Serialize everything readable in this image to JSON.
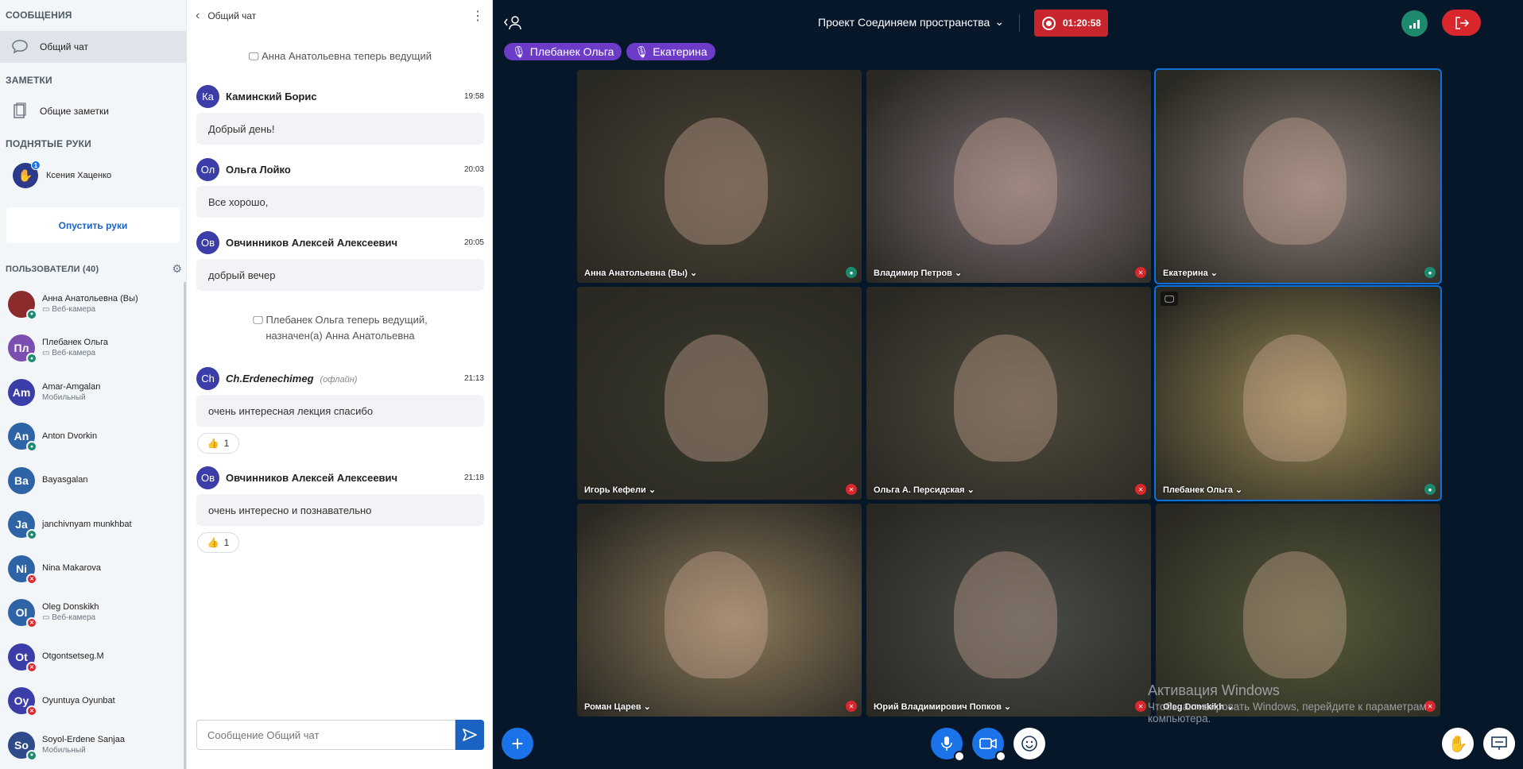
{
  "sidebar": {
    "messages_title": "СООБЩЕНИЯ",
    "public_chat": "Общий чат",
    "notes_title": "ЗАМЕТКИ",
    "shared_notes": "Общие заметки",
    "raised_hands_title": "ПОДНЯТЫЕ РУКИ",
    "raised_hand_user": "Ксения Хаценко",
    "raised_hand_count": "1",
    "lower_hands": "Опустить руки",
    "users_title": "ПОЛЬЗОВАТЕЛИ (40)",
    "users": [
      {
        "initials": "",
        "name": "Анна Анатольевна (Вы)",
        "sub": "▭ Веб-камера",
        "color": "#8b2b2b"
      },
      {
        "initials": "Пл",
        "name": "Плебанек Ольга",
        "sub": "▭ Веб-камера",
        "color": "#7a4fb0"
      },
      {
        "initials": "Am",
        "name": "Amar-Amgalan",
        "sub": "Мобильный",
        "color": "#3b3ea8"
      },
      {
        "initials": "An",
        "name": "Anton Dvorkin",
        "sub": "",
        "color": "#2e63a6"
      },
      {
        "initials": "Ba",
        "name": "Bayasgalan",
        "sub": "",
        "color": "#2e63a6"
      },
      {
        "initials": "Ja",
        "name": "janchivnyam munkhbat",
        "sub": "",
        "color": "#2e63a6"
      },
      {
        "initials": "Ni",
        "name": "Nina Makarova",
        "sub": "",
        "color": "#2e63a6"
      },
      {
        "initials": "Ol",
        "name": "Oleg Donskikh",
        "sub": "▭ Веб-камера",
        "color": "#2e63a6"
      },
      {
        "initials": "Ot",
        "name": "Otgontsetseg.M",
        "sub": "",
        "color": "#3b3ea8"
      },
      {
        "initials": "Oy",
        "name": "Oyuntuya Oyunbat",
        "sub": "",
        "color": "#3b3ea8"
      },
      {
        "initials": "So",
        "name": "Soyol-Erdene Sanjaa",
        "sub": "Мобильный",
        "color": "#2e4a8a"
      }
    ]
  },
  "chat": {
    "title": "Общий чат",
    "sys1": "Анна Анатольевна теперь ведущий",
    "sys2_line1": "Плебанек Ольга теперь ведущий,",
    "sys2_line2": "назначен(а) Анна Анатольевна",
    "messages": [
      {
        "initials": "Ка",
        "name": "Каминский Борис",
        "time": "19:58",
        "text": "Добрый день!"
      },
      {
        "initials": "Ол",
        "name": "Ольга Лойко",
        "time": "20:03",
        "text": "Все хорошо,"
      },
      {
        "initials": "Ов",
        "name": "Овчинников Алексей Алексеевич",
        "time": "20:05",
        "text": "добрый вечер"
      },
      {
        "initials": "Ch",
        "name": "Ch.Erdenechimeg",
        "offline": "(офлайн)",
        "time": "21:13",
        "text": "очень интересная лекция спасибо",
        "reactions": "1"
      },
      {
        "initials": "Ов",
        "name": "Овчинников Алексей Алексеевич",
        "time": "21:18",
        "text": "очень интересно и познавательно",
        "reactions": "1"
      }
    ],
    "input_placeholder": "Сообщение Общий чат"
  },
  "topbar": {
    "meeting_title": "Проект Соединяем пространства",
    "timer": "01:20:58",
    "talkers": [
      "Плебанек Ольга",
      "Екатерина"
    ]
  },
  "videos": [
    {
      "name": "Анна Анатольевна (Вы)",
      "bg": "#4a4436",
      "muted": false
    },
    {
      "name": "Владимир Петров",
      "bg": "#7d6f74",
      "muted": true
    },
    {
      "name": "Екатерина",
      "bg": "#8a7c78",
      "muted": false
    },
    {
      "name": "Игорь Кефели",
      "bg": "#3a3a2c",
      "muted": true
    },
    {
      "name": "Ольга А. Персидская",
      "bg": "#4e4a3c",
      "muted": true
    },
    {
      "name": "Плебанек Ольга",
      "bg": "#9a8a56",
      "muted": false
    },
    {
      "name": "Роман Царев",
      "bg": "#8c7a5c",
      "muted": true
    },
    {
      "name": "Юрий Владимирович Попков",
      "bg": "#4a4c48",
      "muted": true
    },
    {
      "name": "Oleg Donskikh",
      "bg": "#565a3a",
      "muted": true
    }
  ],
  "watermark": {
    "line1": "Активация Windows",
    "line2": "Чтобы активировать Windows, перейдите к параметрам",
    "line3": "компьютера."
  }
}
